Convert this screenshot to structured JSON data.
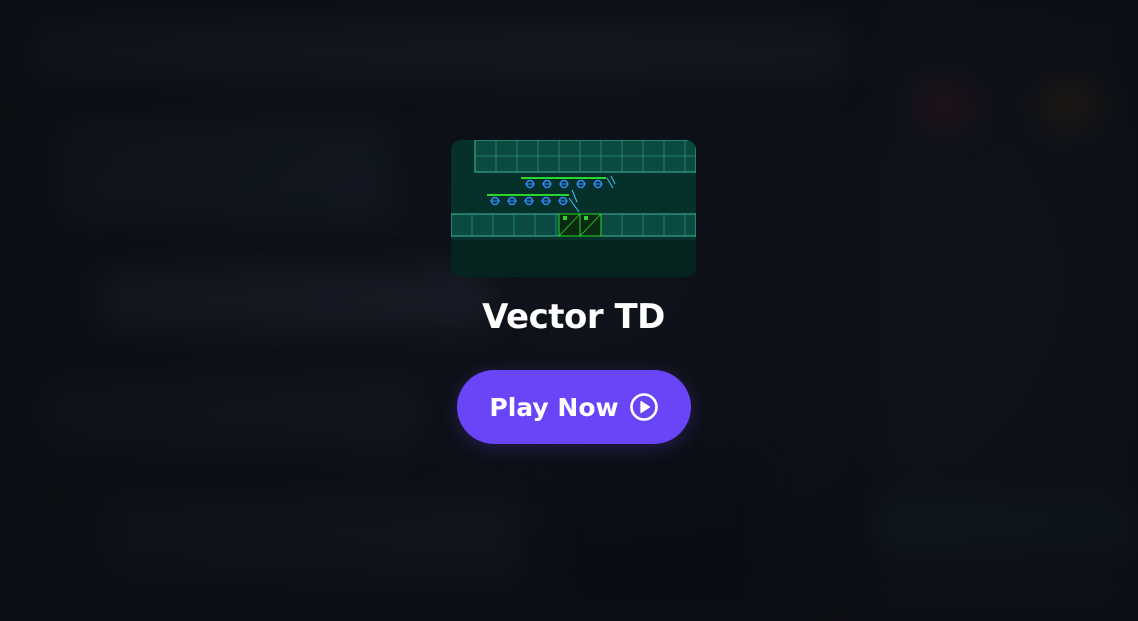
{
  "game": {
    "title": "Vector TD",
    "thumbnail_icon": "game-thumbnail-vector-td"
  },
  "cta": {
    "label": "Play Now",
    "icon": "play-circle-icon",
    "color": "#6a45f8"
  },
  "theme": {
    "background": "#0f121a",
    "thumbnail_bg": "#062a25",
    "thumbnail_grid": "#3fb8a4",
    "tower_green": "#2bd62b",
    "enemy_blue": "#2f8cff"
  }
}
